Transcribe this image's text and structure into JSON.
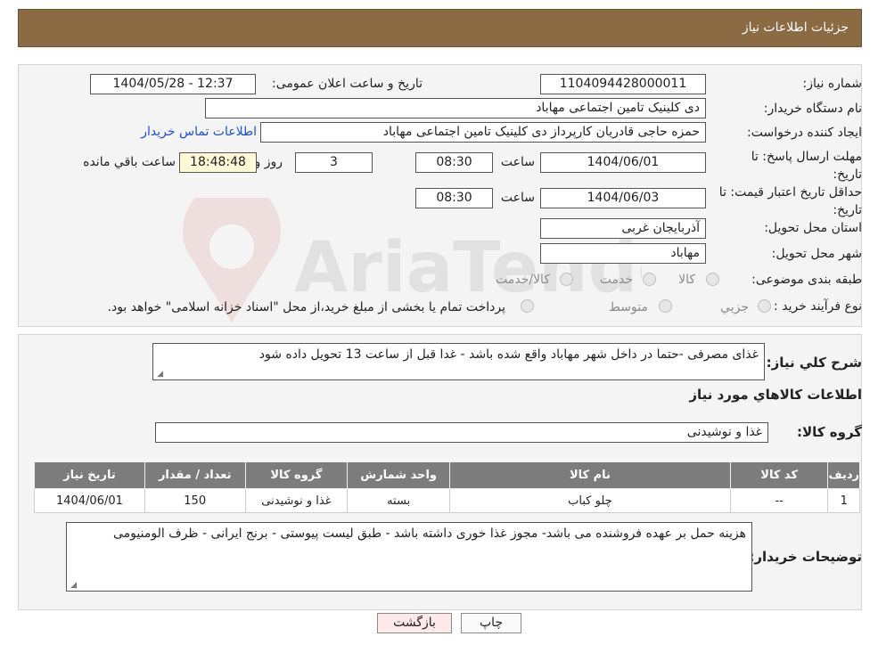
{
  "header": {
    "title": "جزئیات اطلاعات نیاز"
  },
  "fields": {
    "need_number_label": "شماره نیاز:",
    "need_number": "1104094428000011",
    "announce_label": "تاریخ و ساعت اعلان عمومی:",
    "announce_value": "1404/05/28 - 12:37",
    "buyer_org_label": "نام دستگاه خریدار:",
    "buyer_org": "دی کلینیک تامین اجتماعی مهاباد",
    "creator_label": "ایجاد کننده درخواست:",
    "creator": "حمزه حاجی قادریان کارپرداز دی کلینیک تامین اجتماعی مهاباد",
    "contact_link": "اطلاعات تماس خریدار",
    "deadline_label": "مهلت ارسال پاسخ: تا تاریخ:",
    "deadline_date": "1404/06/01",
    "time_label": "ساعت",
    "deadline_time": "08:30",
    "days_value": "3",
    "days_label": "روز و",
    "remaining_time": "18:48:48",
    "remaining_label": "ساعت باقي مانده",
    "validity_label": "حداقل تاریخ اعتبار قیمت: تا تاریخ:",
    "validity_date": "1404/06/03",
    "validity_time": "08:30",
    "province_label": "استان محل تحویل:",
    "province": "آذربایجان غربی",
    "city_label": "شهر محل تحویل:",
    "city": "مهاباد",
    "category_label": "طبقه بندی موضوعی:",
    "category_options": [
      "کالا",
      "خدمت",
      "کالا/خدمت"
    ],
    "process_label": "نوع فرآیند خرید :",
    "process_options": [
      "جزیي",
      "متوسط"
    ],
    "process_note": "پرداخت تمام یا بخشی از مبلغ خرید،از محل \"اسناد خزانه اسلامی\" خواهد بود."
  },
  "description": {
    "label": "شرح کلي نیاز:",
    "text": "غذای مصرفی -حتما در داخل شهر مهاباد  واقع شده باشد - غدا قبل از ساعت 13 تحویل داده شود",
    "items_title": "اطلاعات کالاهاي مورد نیاز",
    "group_label": "گروه کالا:",
    "group_value": "غذا و نوشیدنی"
  },
  "table": {
    "headers": [
      "ردیف",
      "کد کالا",
      "نام کالا",
      "واحد شمارش",
      "گروه کالا",
      "تعداد / مقدار",
      "تاریخ نیاز"
    ],
    "rows": [
      [
        "1",
        "--",
        "چلو کباب",
        "بسته",
        "غذا و نوشیدنی",
        "150",
        "1404/06/01"
      ]
    ]
  },
  "notes": {
    "label": "توضیحات خریدار:",
    "text": "هزینه حمل بر عهده فروشنده  می باشد- مجوز غذا خوری داشته باشد - طبق لیست پیوستی - برنج ایرانی - ظرف الومنیومی"
  },
  "buttons": {
    "print": "چاپ",
    "back": "بازگشت"
  },
  "watermark": {
    "text": "AriaTender.neT"
  },
  "colors": {
    "header_bg": "#8b6b43",
    "link": "#1a4fd6",
    "back_button_bg": "#fde8ea"
  }
}
